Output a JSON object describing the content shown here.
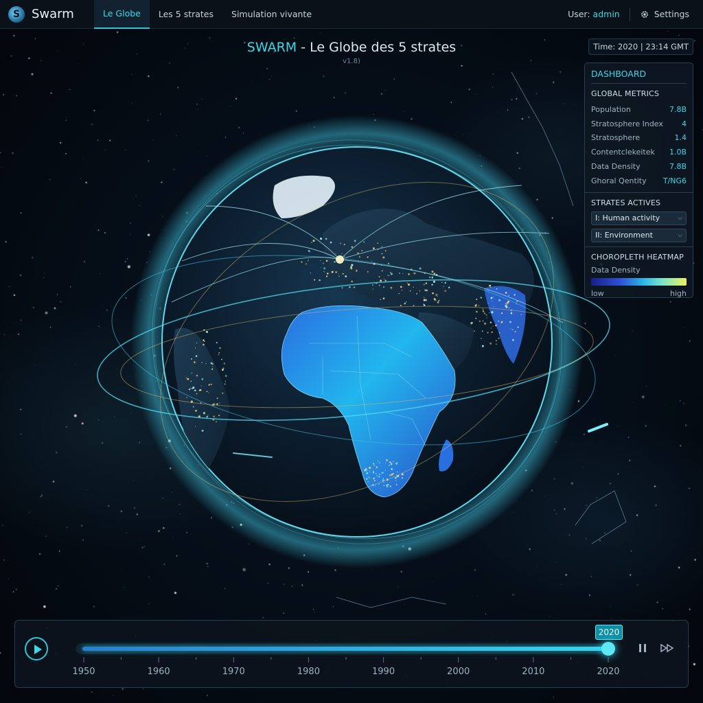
{
  "nav": {
    "brand_logo": "S",
    "brand_name": "Swarm",
    "tabs": [
      "Le Globe",
      "Les 5 strates",
      "Simulation vivante"
    ],
    "active_tab": 0,
    "user_label": "User:",
    "user_name": "admin",
    "settings_label": "Settings",
    "icons": {
      "brand": "swarm-logo-icon",
      "settings": "gear-icon"
    }
  },
  "header": {
    "title_accent": "SWARM",
    "title_rest": " - Le Globe des 5 strates",
    "version": "v1.8)",
    "time": "Time: 2020 | 23:14 GMT"
  },
  "dashboard": {
    "title": "DASHBOARD",
    "global_metrics": {
      "heading": "GLOBAL METRICS",
      "rows": [
        {
          "label": "Population",
          "value": "7.8B"
        },
        {
          "label": "Stratosphere Index",
          "value": "4"
        },
        {
          "label": "Stratosphere",
          "value": "1.4"
        },
        {
          "label": "Contentclekeitek",
          "value": "1.0B"
        },
        {
          "label": "Data Density",
          "value": "7.8B"
        },
        {
          "label": "Ghoral Qentity",
          "value": "T/NG6"
        }
      ]
    },
    "strates": {
      "heading": "STRATES ACTIVES",
      "items": [
        "I: Human activity",
        "II: Environment"
      ]
    },
    "heatmap": {
      "heading": "CHOROPLETH HEATMAP",
      "subtitle": "Data Density",
      "low": "low",
      "high": "high"
    }
  },
  "timeline": {
    "current_year": "2020",
    "start_year": 1950,
    "end_year": 2020,
    "progress": 1.0,
    "labels": [
      "1950",
      "1960",
      "1970",
      "1980",
      "1990",
      "2000",
      "2010",
      "2020"
    ],
    "icons": {
      "play": "play-icon",
      "pause": "pause-icon",
      "fast_forward": "fast-forward-icon"
    }
  },
  "colors": {
    "accent": "#3fd6e6",
    "panel_bg": "#0e1822",
    "heat_low": "#1a1f8a",
    "heat_high": "#eef05a"
  }
}
